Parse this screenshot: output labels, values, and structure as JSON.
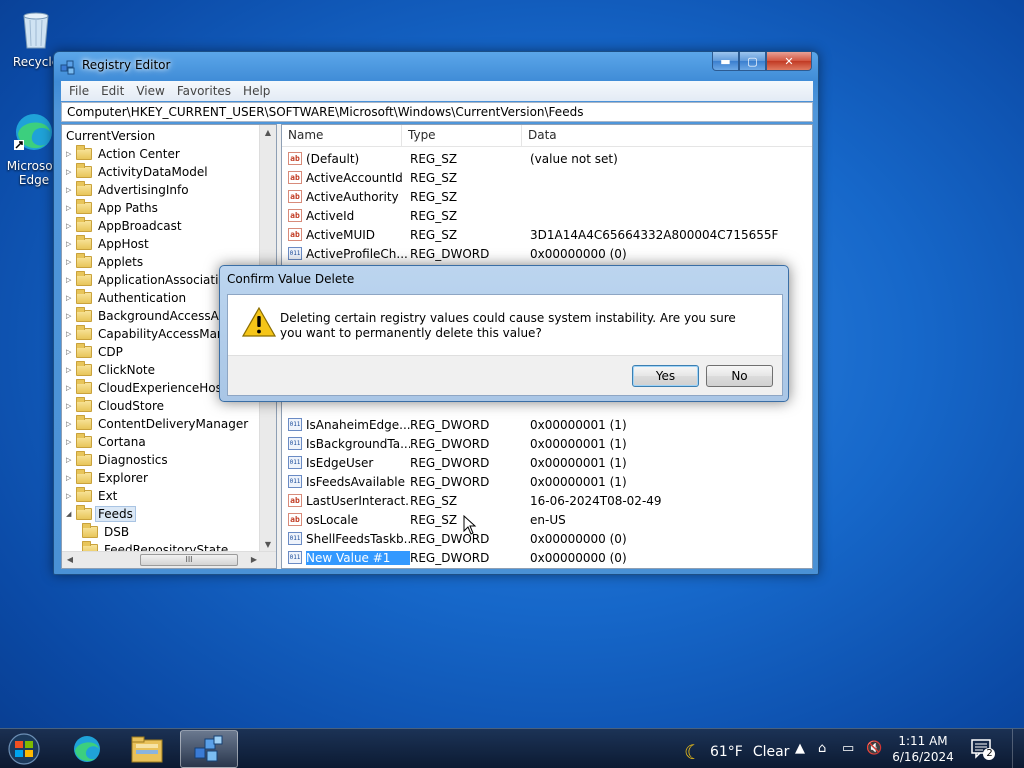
{
  "desktop": {
    "icons": [
      {
        "label": "Recycle",
        "icon": "recycle-bin-icon"
      },
      {
        "label": "Microsoft Edge",
        "icon": "edge-icon"
      }
    ]
  },
  "window": {
    "title": "Registry Editor",
    "menu": [
      "File",
      "Edit",
      "View",
      "Favorites",
      "Help"
    ],
    "address": "Computer\\HKEY_CURRENT_USER\\SOFTWARE\\Microsoft\\Windows\\CurrentVersion\\Feeds"
  },
  "tree": {
    "root": "CurrentVersion",
    "items": [
      "Action Center",
      "ActivityDataModel",
      "AdvertisingInfo",
      "App Paths",
      "AppBroadcast",
      "AppHost",
      "Applets",
      "ApplicationAssociationT",
      "Authentication",
      "BackgroundAccessAppli",
      "CapabilityAccessManage",
      "CDP",
      "ClickNote",
      "CloudExperienceHost",
      "CloudStore",
      "ContentDeliveryManager",
      "Cortana",
      "Diagnostics",
      "Explorer",
      "Ext",
      "Feeds"
    ],
    "selected": "Feeds",
    "children": [
      "DSB",
      "FeedRepositoryState"
    ],
    "hscroll_thumb": "III"
  },
  "list": {
    "columns": [
      "Name",
      "Type",
      "Data"
    ],
    "rows": [
      {
        "name": "(Default)",
        "type": "REG_SZ",
        "data": "(value not set)",
        "icon": "string-value-icon"
      },
      {
        "name": "ActiveAccountId",
        "type": "REG_SZ",
        "data": "",
        "icon": "string-value-icon"
      },
      {
        "name": "ActiveAuthority",
        "type": "REG_SZ",
        "data": "",
        "icon": "string-value-icon"
      },
      {
        "name": "ActiveId",
        "type": "REG_SZ",
        "data": "",
        "icon": "string-value-icon"
      },
      {
        "name": "ActiveMUID",
        "type": "REG_SZ",
        "data": "3D1A14A4C65664332A800004C715655F",
        "icon": "string-value-icon"
      },
      {
        "name": "ActiveProfileCh...",
        "type": "REG_DWORD",
        "data": "0x00000000 (0)",
        "icon": "dword-value-icon"
      },
      {
        "name": "IsAnaheimEdge...",
        "type": "REG_DWORD",
        "data": "0x00000001 (1)",
        "icon": "dword-value-icon"
      },
      {
        "name": "IsBackgroundTa...",
        "type": "REG_DWORD",
        "data": "0x00000001 (1)",
        "icon": "dword-value-icon"
      },
      {
        "name": "IsEdgeUser",
        "type": "REG_DWORD",
        "data": "0x00000001 (1)",
        "icon": "dword-value-icon"
      },
      {
        "name": "IsFeedsAvailable",
        "type": "REG_DWORD",
        "data": "0x00000001 (1)",
        "icon": "dword-value-icon"
      },
      {
        "name": "LastUserInteract...",
        "type": "REG_SZ",
        "data": "16-06-2024T08-02-49",
        "icon": "string-value-icon"
      },
      {
        "name": "osLocale",
        "type": "REG_SZ",
        "data": "en-US",
        "icon": "string-value-icon"
      },
      {
        "name": "ShellFeedsTaskb...",
        "type": "REG_DWORD",
        "data": "0x00000000 (0)",
        "icon": "dword-value-icon"
      },
      {
        "name": "New Value #1",
        "type": "REG_DWORD",
        "data": "0x00000000 (0)",
        "icon": "dword-value-icon",
        "selected": true
      }
    ]
  },
  "dialog": {
    "title": "Confirm Value Delete",
    "message": "Deleting certain registry values could cause system instability. Are you sure you want to permanently delete this value?",
    "icon": "warning-icon",
    "yes_label": "Yes",
    "no_label": "No"
  },
  "taskbar": {
    "apps": [
      "start-orb-icon",
      "edge-icon",
      "file-explorer-icon",
      "registry-editor-icon"
    ],
    "weather_temp": "61°F",
    "weather_desc": "Clear",
    "time": "1:11 AM",
    "date": "6/16/2024",
    "notification_count": "2"
  }
}
